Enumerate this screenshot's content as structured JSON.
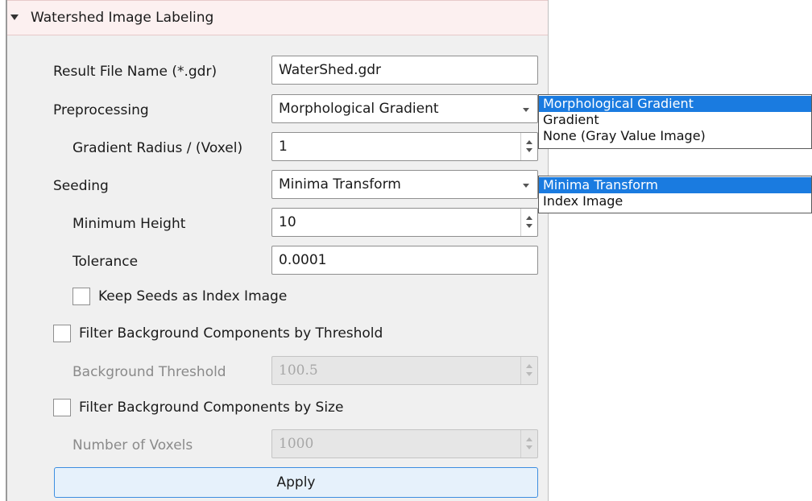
{
  "panel": {
    "title": "Watershed Image Labeling"
  },
  "form": {
    "result_file_label": "Result File Name (*.gdr)",
    "result_file_value": "WaterShed.gdr",
    "preprocessing_label": "Preprocessing",
    "preprocessing_value": "Morphological Gradient",
    "gradient_radius_label": "Gradient Radius / (Voxel)",
    "gradient_radius_value": "1",
    "seeding_label": "Seeding",
    "seeding_value": "Minima Transform",
    "minimum_height_label": "Minimum Height",
    "minimum_height_value": "10",
    "tolerance_label": "Tolerance",
    "tolerance_value": "0.0001",
    "keep_seeds_label": "Keep Seeds as Index Image",
    "keep_seeds_checked": false,
    "filter_threshold_label": "Filter Background Components by Threshold",
    "filter_threshold_checked": false,
    "background_threshold_label": "Background Threshold",
    "background_threshold_value": "100.5",
    "filter_size_label": "Filter Background Components by Size",
    "filter_size_checked": false,
    "number_of_voxels_label": "Number of Voxels",
    "number_of_voxels_value": "1000",
    "apply_label": "Apply"
  },
  "preprocessing_dropdown": {
    "options": [
      "Morphological Gradient",
      "Gradient",
      "None (Gray Value Image)"
    ],
    "selected_index": 0
  },
  "seeding_dropdown": {
    "options": [
      "Minima Transform",
      "Index Image"
    ],
    "selected_index": 0
  },
  "colors": {
    "selection": "#1a7be0",
    "header_background": "#fcf0f0",
    "apply_border": "#3d8ee0"
  }
}
